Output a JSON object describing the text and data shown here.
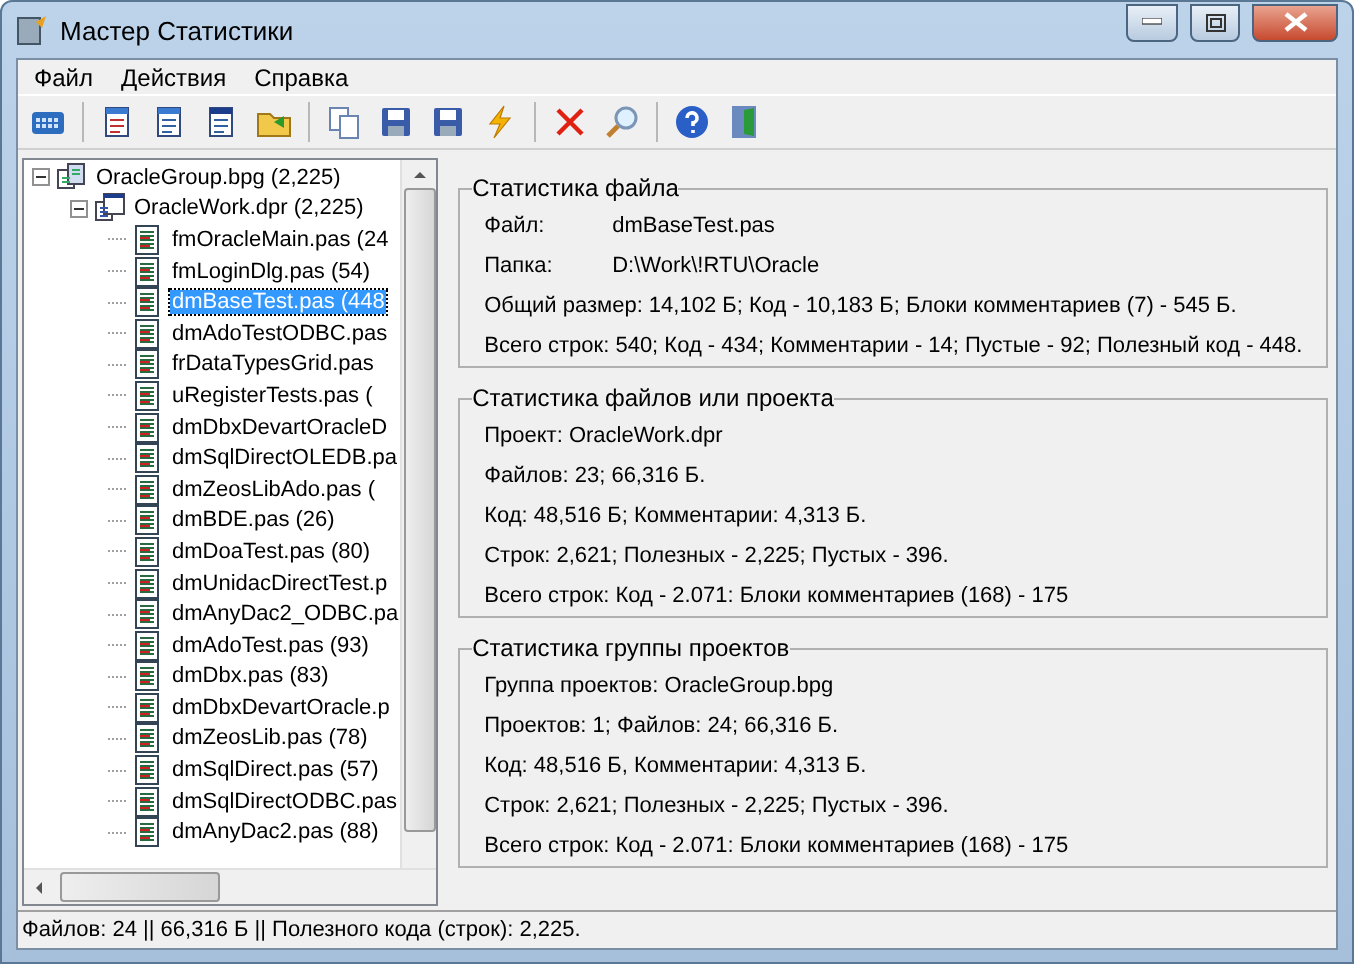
{
  "window": {
    "title": "Мастер Статистики"
  },
  "menu": [
    {
      "label": "Файл"
    },
    {
      "label": "Действия"
    },
    {
      "label": "Справка"
    }
  ],
  "toolbar": [
    {
      "kind": "grid"
    },
    {
      "kind": "sep"
    },
    {
      "kind": "doc"
    },
    {
      "kind": "docs"
    },
    {
      "kind": "form"
    },
    {
      "kind": "folder"
    },
    {
      "kind": "sep"
    },
    {
      "kind": "copy"
    },
    {
      "kind": "save"
    },
    {
      "kind": "saveall"
    },
    {
      "kind": "bolt"
    },
    {
      "kind": "sep"
    },
    {
      "kind": "delete"
    },
    {
      "kind": "search"
    },
    {
      "kind": "sep"
    },
    {
      "kind": "help"
    },
    {
      "kind": "exit"
    }
  ],
  "tree": [
    {
      "label": "OracleGroup.bpg (2,225)",
      "kind": "group",
      "expanded": true,
      "selected": false,
      "children": [
        {
          "label": "OracleWork.dpr (2,225)",
          "kind": "project",
          "expanded": true,
          "selected": false,
          "children": [
            {
              "label": "fmOracleMain.pas (24",
              "kind": "unit",
              "selected": false
            },
            {
              "label": "fmLoginDlg.pas (54)",
              "kind": "unit",
              "selected": false
            },
            {
              "label": "dmBaseTest.pas (448",
              "kind": "unit",
              "selected": true
            },
            {
              "label": "dmAdoTestODBC.pas",
              "kind": "unit",
              "selected": false
            },
            {
              "label": "frDataTypesGrid.pas",
              "kind": "unit",
              "selected": false
            },
            {
              "label": "uRegisterTests.pas (",
              "kind": "unit",
              "selected": false
            },
            {
              "label": "dmDbxDevartOracleD",
              "kind": "unit",
              "selected": false
            },
            {
              "label": "dmSqlDirectOLEDB.pa",
              "kind": "unit",
              "selected": false
            },
            {
              "label": "dmZeosLibAdo.pas (",
              "kind": "unit",
              "selected": false
            },
            {
              "label": "dmBDE.pas (26)",
              "kind": "unit",
              "selected": false
            },
            {
              "label": "dmDoaTest.pas (80)",
              "kind": "unit",
              "selected": false
            },
            {
              "label": "dmUnidacDirectTest.p",
              "kind": "unit",
              "selected": false
            },
            {
              "label": "dmAnyDac2_ODBC.pa",
              "kind": "unit",
              "selected": false
            },
            {
              "label": "dmAdoTest.pas (93)",
              "kind": "unit",
              "selected": false
            },
            {
              "label": "dmDbx.pas (83)",
              "kind": "unit",
              "selected": false
            },
            {
              "label": "dmDbxDevartOracle.p",
              "kind": "unit",
              "selected": false
            },
            {
              "label": "dmZeosLib.pas (78)",
              "kind": "unit",
              "selected": false
            },
            {
              "label": "dmSqlDirect.pas (57)",
              "kind": "unit",
              "selected": false
            },
            {
              "label": "dmSqlDirectODBC.pas",
              "kind": "unit",
              "selected": false
            },
            {
              "label": "dmAnyDac2.pas (88)",
              "kind": "unit",
              "selected": false
            }
          ]
        }
      ]
    }
  ],
  "file_stats": {
    "title": "Статистика файла",
    "fields": [
      {
        "label": "Файл:",
        "value": "dmBaseTest.pas"
      },
      {
        "label": "Папка:",
        "value": "D:\\Work\\!RTU\\Oracle"
      }
    ],
    "lines": [
      "Общий размер: 14,102 Б; Код - 10,183 Б; Блоки комментариев (7) - 545 Б.",
      "Всего строк: 540; Код - 434; Комментарии - 14; Пустые - 92; Полезный код - 448."
    ]
  },
  "groups": [
    {
      "title": "Статистика файлов или проекта",
      "lines": [
        "Проект: OracleWork.dpr",
        "Файлов: 23; 66,316 Б.",
        "Код: 48,516 Б; Комментарии: 4,313 Б.",
        "Строк: 2,621; Полезных - 2,225; Пустых - 396.",
        "Всего строк: Код - 2.071: Блоки комментариев (168) - 175"
      ]
    },
    {
      "title": "Статистика группы проектов",
      "lines": [
        "Группа проектов: OracleGroup.bpg",
        "Проектов: 1; Файлов: 24; 66,316 Б.",
        "Код: 48,516 Б, Комментарии: 4,313 Б.",
        "Строк: 2,621; Полезных - 2,225; Пустых - 396.",
        "Всего строк: Код - 2.071: Блоки комментариев (168) - 175"
      ]
    }
  ],
  "status_bar": "Файлов: 24 || 66,316 Б || Полезного кода (строк): 2,225."
}
